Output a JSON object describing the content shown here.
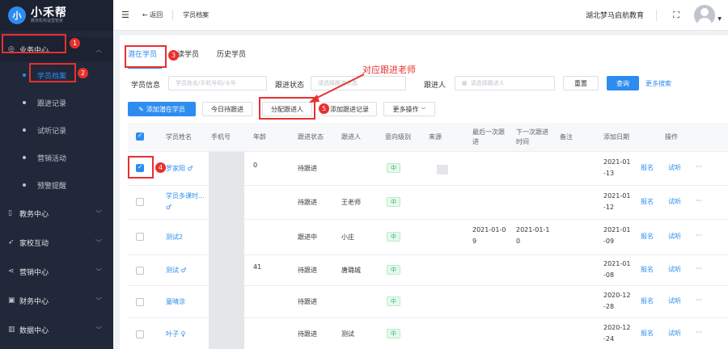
{
  "brand": {
    "logo_mark": "小",
    "name": "小禾帮",
    "slogan": "教培机构运营管家"
  },
  "sidebar": {
    "group": "业务中心",
    "sub_items": [
      {
        "label": "学员档案",
        "active": true
      },
      {
        "label": "跟进记录"
      },
      {
        "label": "试听记录"
      },
      {
        "label": "营销活动"
      },
      {
        "label": "预警提醒"
      }
    ],
    "sections": [
      "教务中心",
      "家校互动",
      "营销中心",
      "财务中心",
      "数据中心"
    ]
  },
  "topbar": {
    "back": "返回",
    "breadcrumb": "学员档案",
    "org": "湖北梦马启航教育"
  },
  "tabs": [
    "潜在学员",
    "在读学员",
    "历史学员"
  ],
  "filter": {
    "info_label": "学员信息",
    "info_placeholder": "学员姓名/手机号码/卡号",
    "status_label": "跟进状态",
    "status_placeholder": "请选择跟进状态",
    "person_label": "跟进人",
    "person_placeholder": "请选择跟进人",
    "reset": "重置",
    "query": "查询",
    "more_search": "更多搜索"
  },
  "actions": {
    "add": "添加潜在学员",
    "today": "今日待跟进",
    "assign": "分配跟进人",
    "add_record": "添加跟进记录",
    "more": "更多操作"
  },
  "annotation": {
    "text": "对应跟进老师",
    "badges": [
      "1",
      "2",
      "3",
      "4",
      "5"
    ]
  },
  "table": {
    "headers": [
      "学员姓名",
      "手机号",
      "年龄",
      "跟进状态",
      "跟进人",
      "意向级别",
      "来源",
      "最后一次跟进",
      "下一次跟进时间",
      "备注",
      "添加日期",
      "操作"
    ],
    "rows": [
      {
        "name": "罗家阳 ♂",
        "age": "0",
        "status": "待跟进",
        "follower": "",
        "level": "中",
        "last": "",
        "next": "",
        "date": "2021-01-13",
        "checked": true
      },
      {
        "name": "学员多课时...♂",
        "age": "",
        "status": "待跟进",
        "follower": "王老师",
        "level": "中",
        "last": "",
        "next": "",
        "date": "2021-01-12",
        "checked": false
      },
      {
        "name": "测试2",
        "age": "",
        "status": "跟进中",
        "follower": "小庄",
        "level": "中",
        "last": "2021-01-09",
        "next": "2021-01-10",
        "date": "2021-01-09",
        "checked": false
      },
      {
        "name": "测试 ♂",
        "age": "41",
        "status": "待跟进",
        "follower": "唐璐城",
        "level": "中",
        "last": "",
        "next": "",
        "date": "2021-01-08",
        "checked": false
      },
      {
        "name": "童晴涂",
        "age": "",
        "status": "待跟进",
        "follower": "",
        "level": "中",
        "last": "",
        "next": "",
        "date": "2020-12-28",
        "checked": false
      },
      {
        "name": "叶子 ♀",
        "age": "",
        "status": "待跟进",
        "follower": "测试",
        "level": "中",
        "last": "",
        "next": "",
        "date": "2020-12-24",
        "checked": false
      }
    ],
    "op_labels": [
      "报名",
      "试听",
      "···"
    ]
  },
  "colors": {
    "accent": "#2d8cf0",
    "annotation": "#e8302f",
    "sidebar": "#21283a",
    "tag_green": "#19be6b"
  }
}
